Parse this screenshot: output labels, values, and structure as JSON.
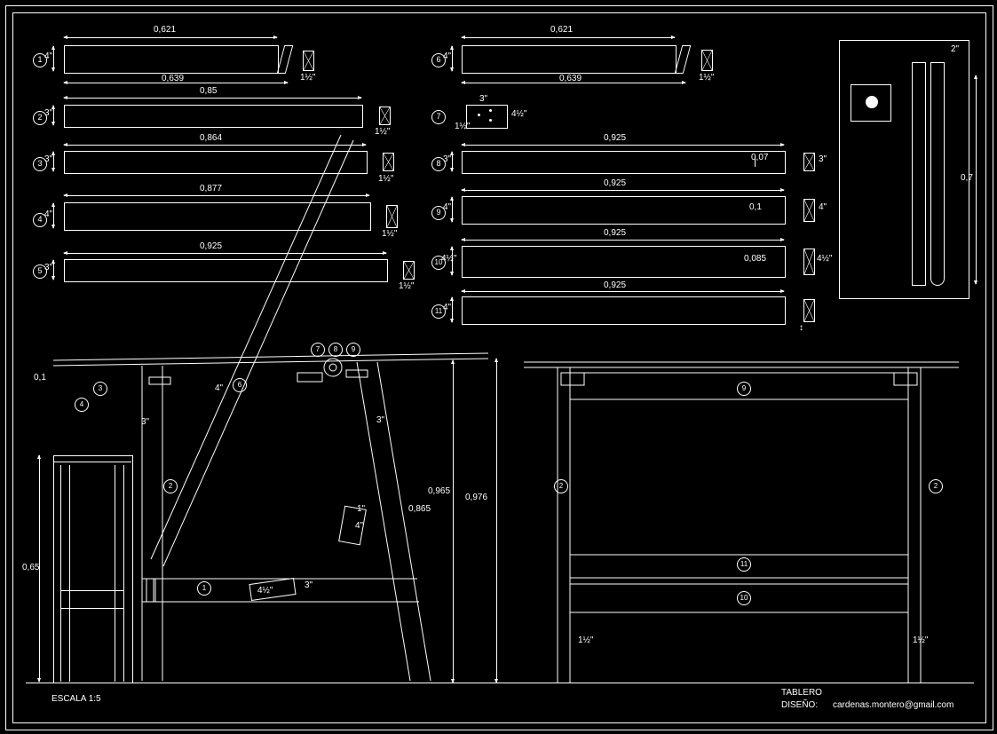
{
  "title_block": {
    "name": "TABLERO",
    "design_label": "DISEÑO:",
    "designer": "cardenas.montero@gmail.com",
    "scale_label": "ESCALA 1:5"
  },
  "parts": {
    "p1": {
      "num": "1",
      "len": "0,621",
      "h": "4\"",
      "extra": "0,639",
      "sec": "1½\""
    },
    "p2": {
      "num": "2",
      "len": "0,85",
      "h": "3\"",
      "sec": "1½\""
    },
    "p3": {
      "num": "3",
      "len": "0,864",
      "h": "3\"",
      "sec": "1½\""
    },
    "p4": {
      "num": "4",
      "len": "0,877",
      "h": "4\"",
      "sec": "1½\""
    },
    "p5": {
      "num": "5",
      "len": "0,925",
      "h": "3\"",
      "sec": "1½\""
    },
    "p6": {
      "num": "6",
      "len": "0,621",
      "h": "4\"",
      "extra": "0,639",
      "sec": "1½\""
    },
    "p7": {
      "num": "7",
      "w": "3\"",
      "h": "1½\"",
      "sec": "4½\""
    },
    "p8": {
      "num": "8",
      "len": "0,925",
      "h": "3\"",
      "gap": "0,07",
      "sec": "3\""
    },
    "p9": {
      "num": "9",
      "len": "0,925",
      "h": "4\"",
      "gap": "0,1",
      "sec": "4\""
    },
    "p10": {
      "num": "10",
      "len": "0,925",
      "h": "4½\"",
      "gap": "0,085",
      "sec": "4½\""
    },
    "p11": {
      "num": "11",
      "len": "0,925",
      "h": "4\""
    }
  },
  "assembly": {
    "front": {
      "height": "0,1",
      "leg_w": "3\"",
      "rail_h": "4\"",
      "brace_w1": "3\"",
      "brace_w2": "3\"",
      "brace_h": "4½\"",
      "hinge": "1\"",
      "hinge2": "4\"",
      "dim1": "0,965",
      "dim2": "0,865",
      "dim3": "0,976"
    },
    "side": {
      "height": "0,65"
    },
    "elev": {
      "leg_gap_l": "1½\"",
      "leg_gap_r": "1½\""
    },
    "detail": {
      "w": "2\"",
      "h": "0,7"
    }
  },
  "callouts": [
    "1",
    "2",
    "3",
    "4",
    "5",
    "6",
    "7",
    "8",
    "9",
    "10",
    "11"
  ]
}
